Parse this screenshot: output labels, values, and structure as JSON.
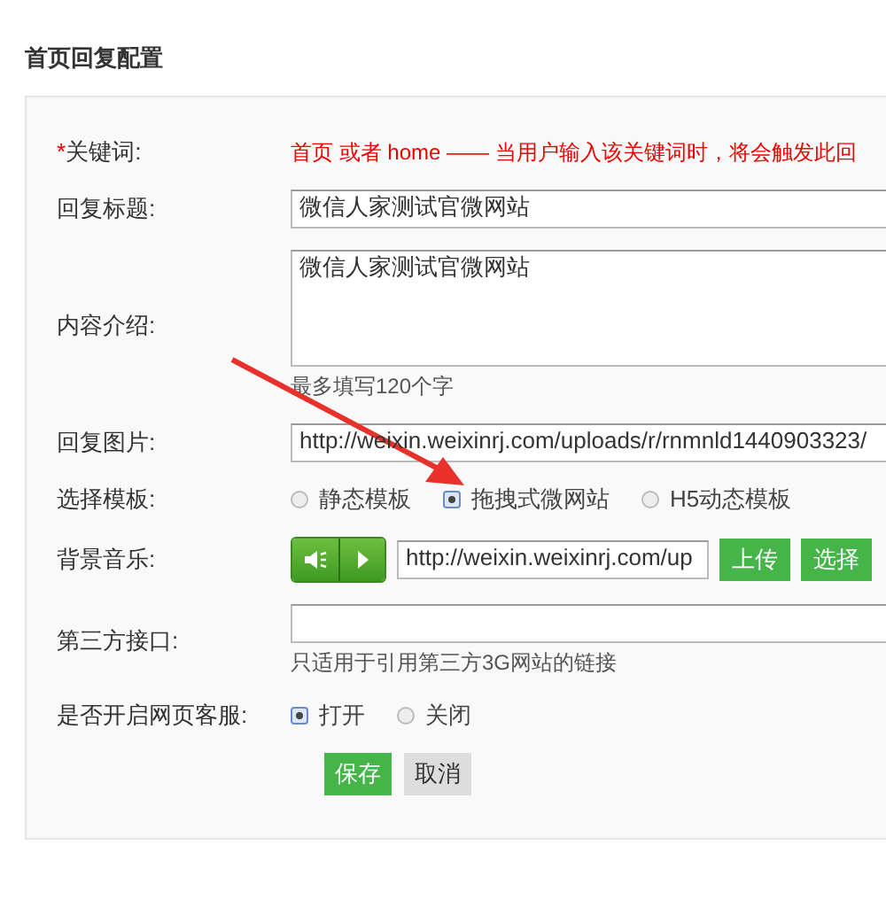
{
  "page_title": "首页回复配置",
  "form": {
    "rows": [
      {
        "kind": "note",
        "label": "关键词:",
        "required_mark": "*",
        "text": "首页 或者 home —— 当用户输入该关键词时，将会触发此回"
      },
      {
        "kind": "text",
        "label": "回复标题:",
        "value": "微信人家测试官微网站"
      },
      {
        "kind": "textarea",
        "label": "内容介绍:",
        "value": "微信人家测试官微网站",
        "hint": "最多填写120个字"
      },
      {
        "kind": "text",
        "label": "回复图片:",
        "value": "http://weixin.weixinrj.com/uploads/r/rnmnld1440903323/"
      },
      {
        "kind": "radio",
        "label": "选择模板:",
        "options": [
          {
            "label": "静态模板",
            "selected": false
          },
          {
            "label": "拖拽式微网站",
            "selected": true
          },
          {
            "label": "H5动态模板",
            "selected": false
          }
        ]
      },
      {
        "kind": "music",
        "label": "背景音乐:",
        "value": "http://weixin.weixinrj.com/up",
        "buttons": [
          "上传",
          "选择"
        ]
      },
      {
        "kind": "text",
        "label": "第三方接口:",
        "value": "",
        "hint": "只适用于引用第三方3G网站的链接"
      },
      {
        "kind": "radio",
        "label": "是否开启网页客服:",
        "options": [
          {
            "label": "打开",
            "selected": true
          },
          {
            "label": "关闭",
            "selected": false
          }
        ]
      }
    ],
    "actions": [
      {
        "label": "保存",
        "kind": "primary"
      },
      {
        "label": "取消",
        "kind": "secondary"
      }
    ]
  }
}
